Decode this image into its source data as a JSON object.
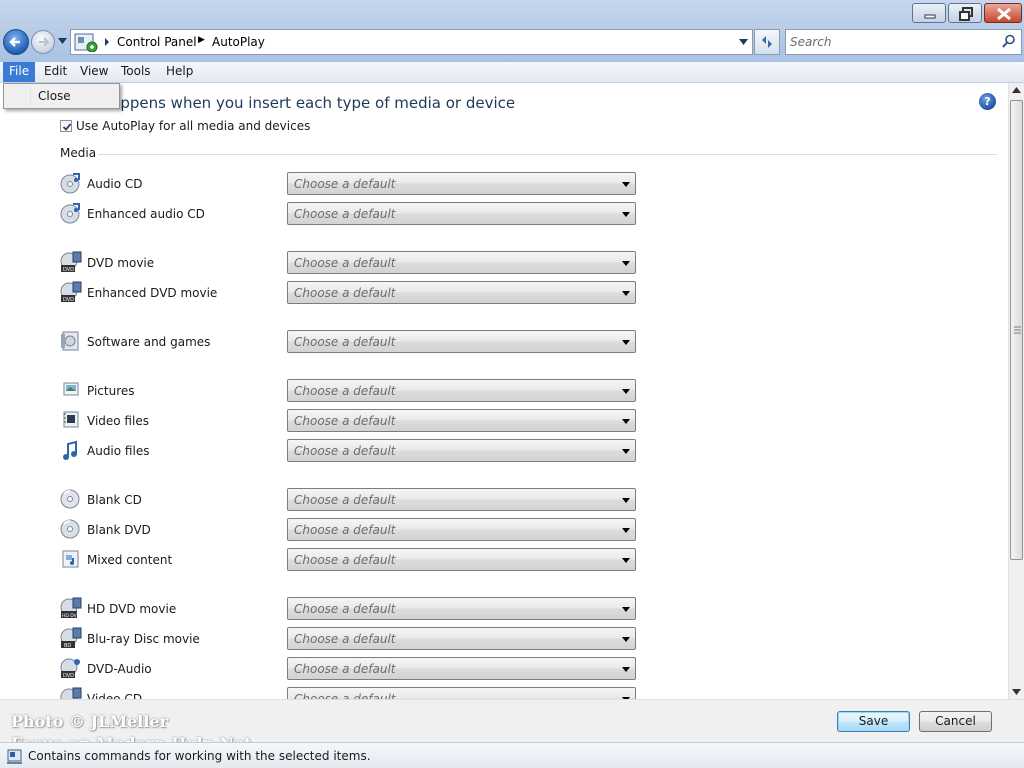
{
  "window": {
    "minimize_icon": "minimize-icon",
    "maximize_icon": "restore-icon",
    "close_icon": "close-icon"
  },
  "address_bar": {
    "breadcrumbs": [
      "Control Panel",
      "AutoPlay"
    ]
  },
  "search": {
    "placeholder": "Search"
  },
  "menu": {
    "items": [
      "File",
      "Edit",
      "View",
      "Tools",
      "Help"
    ],
    "active": "File",
    "file_dropdown": [
      "Close"
    ]
  },
  "main": {
    "heading": "what happens when you insert each type of media or device",
    "use_autoplay_label": "Use AutoPlay for all media and devices",
    "use_autoplay_checked": true,
    "group_label": "Media",
    "rows": [
      {
        "label": "Audio CD",
        "value": "Choose a default",
        "icon": "audio-cd-icon"
      },
      {
        "label": "Enhanced audio CD",
        "value": "Choose a default",
        "icon": "audio-cd-icon"
      },
      {
        "label": "DVD movie",
        "value": "Choose a default",
        "icon": "dvd-movie-icon"
      },
      {
        "label": "Enhanced DVD movie",
        "value": "Choose a default",
        "icon": "dvd-movie-icon"
      },
      {
        "label": "Software and games",
        "value": "Choose a default",
        "icon": "software-icon"
      },
      {
        "label": "Pictures",
        "value": "Choose a default",
        "icon": "pictures-icon"
      },
      {
        "label": "Video files",
        "value": "Choose a default",
        "icon": "video-files-icon"
      },
      {
        "label": "Audio files",
        "value": "Choose a default",
        "icon": "audio-files-icon"
      },
      {
        "label": "Blank CD",
        "value": "Choose a default",
        "icon": "blank-cd-icon"
      },
      {
        "label": "Blank DVD",
        "value": "Choose a default",
        "icon": "blank-dvd-icon"
      },
      {
        "label": "Mixed content",
        "value": "Choose a default",
        "icon": "mixed-content-icon"
      },
      {
        "label": "HD DVD movie",
        "value": "Choose a default",
        "icon": "hd-dvd-icon"
      },
      {
        "label": "Blu-ray Disc movie",
        "value": "Choose a default",
        "icon": "bluray-icon"
      },
      {
        "label": "DVD-Audio",
        "value": "Choose a default",
        "icon": "dvd-audio-icon"
      },
      {
        "label": "Video CD",
        "value": "Choose a default",
        "icon": "video-cd-icon"
      }
    ]
  },
  "footer": {
    "save_label": "Save",
    "cancel_label": "Cancel",
    "watermark": "Photo © JLMeller",
    "watermark2": "Focus on Modern Help Net"
  },
  "status_bar": {
    "text": "Contains commands for working with the selected items."
  },
  "colors": {
    "accent": "#3a7bd5",
    "heading": "#1e395b",
    "placeholder": "#6d6d6d"
  }
}
